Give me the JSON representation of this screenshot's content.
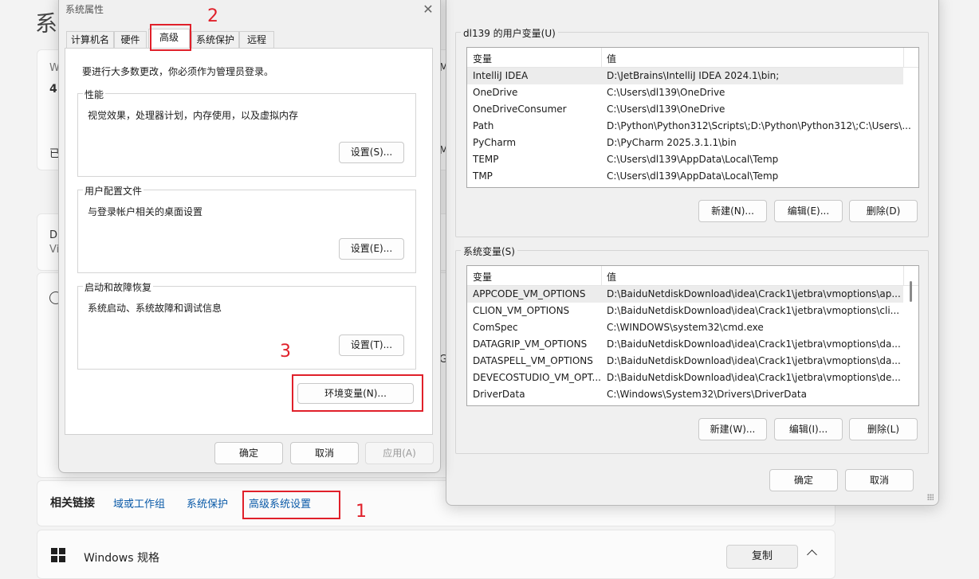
{
  "background": {
    "title_fragment": "系",
    "fragments": [
      "W",
      "4",
      "已",
      "M",
      "MT",
      "Dl",
      "Vi",
      "G"
    ],
    "related_links": {
      "heading": "相关链接",
      "items": [
        "域或工作组",
        "系统保护",
        "高级系统设置"
      ]
    },
    "windows_spec": {
      "title": "Windows 规格",
      "copy_label": "复制"
    }
  },
  "annotations": {
    "step1": "1",
    "step2": "2",
    "step3": "3"
  },
  "env_dialog": {
    "user_group_label": "dl139 的用户变量(U)",
    "col_variable": "变量",
    "col_value": "值",
    "user_vars": [
      {
        "name": "IntelliJ IDEA",
        "value": "D:\\JetBrains\\IntelliJ IDEA 2024.1\\bin;"
      },
      {
        "name": "OneDrive",
        "value": "C:\\Users\\dl139\\OneDrive"
      },
      {
        "name": "OneDriveConsumer",
        "value": "C:\\Users\\dl139\\OneDrive"
      },
      {
        "name": "Path",
        "value": "D:\\Python\\Python312\\Scripts\\;D:\\Python\\Python312\\;C:\\Users\\..."
      },
      {
        "name": "PyCharm",
        "value": "D:\\PyCharm 2025.3.1.1\\bin"
      },
      {
        "name": "TEMP",
        "value": "C:\\Users\\dl139\\AppData\\Local\\Temp"
      },
      {
        "name": "TMP",
        "value": "C:\\Users\\dl139\\AppData\\Local\\Temp"
      }
    ],
    "user_buttons": {
      "new": "新建(N)...",
      "edit": "编辑(E)...",
      "delete": "删除(D)"
    },
    "sys_group_label": "系统变量(S)",
    "sys_vars": [
      {
        "name": "APPCODE_VM_OPTIONS",
        "value": "D:\\BaiduNetdiskDownload\\idea\\Crack1\\jetbra\\vmoptions\\ap..."
      },
      {
        "name": "CLION_VM_OPTIONS",
        "value": "D:\\BaiduNetdiskDownload\\idea\\Crack1\\jetbra\\vmoptions\\cli..."
      },
      {
        "name": "ComSpec",
        "value": "C:\\WINDOWS\\system32\\cmd.exe"
      },
      {
        "name": "DATAGRIP_VM_OPTIONS",
        "value": "D:\\BaiduNetdiskDownload\\idea\\Crack1\\jetbra\\vmoptions\\da..."
      },
      {
        "name": "DATASPELL_VM_OPTIONS",
        "value": "D:\\BaiduNetdiskDownload\\idea\\Crack1\\jetbra\\vmoptions\\da..."
      },
      {
        "name": "DEVECOSTUDIO_VM_OPT...",
        "value": "D:\\BaiduNetdiskDownload\\idea\\Crack1\\jetbra\\vmoptions\\de..."
      },
      {
        "name": "DriverData",
        "value": "C:\\Windows\\System32\\Drivers\\DriverData"
      }
    ],
    "sys_buttons": {
      "new": "新建(W)...",
      "edit": "编辑(I)...",
      "delete": "删除(L)"
    },
    "ok": "确定",
    "cancel": "取消"
  },
  "sys_dialog": {
    "title": "系统属性",
    "close_glyph": "✕",
    "tabs": [
      "计算机名",
      "硬件",
      "高级",
      "系统保护",
      "远程"
    ],
    "active_tab": "高级",
    "admin_note": "要进行大多数更改，你必须作为管理员登录。",
    "performance": {
      "label": "性能",
      "desc": "视觉效果，处理器计划，内存使用，以及虚拟内存",
      "button": "设置(S)..."
    },
    "user_profiles": {
      "label": "用户配置文件",
      "desc": "与登录帐户相关的桌面设置",
      "button": "设置(E)..."
    },
    "startup_recovery": {
      "label": "启动和故障恢复",
      "desc": "系统启动、系统故障和调试信息",
      "button": "设置(T)..."
    },
    "env_button": "环境变量(N)...",
    "ok": "确定",
    "cancel": "取消",
    "apply": "应用(A)"
  }
}
